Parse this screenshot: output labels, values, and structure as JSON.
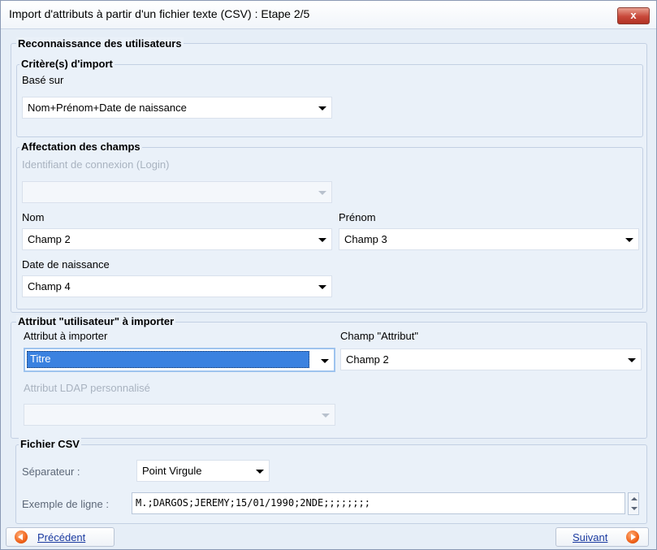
{
  "window": {
    "title": "Import d'attributs à partir d'un fichier texte (CSV) : Etape 2/5",
    "close_label": "x"
  },
  "reconnaissance": {
    "legend": "Reconnaissance des utilisateurs",
    "criteres": {
      "legend": "Critère(s) d'import",
      "base_sur_label": "Basé sur",
      "base_sur_value": "Nom+Prénom+Date de naissance"
    },
    "affectation": {
      "legend": "Affectation des champs",
      "login_label": "Identifiant de connexion (Login)",
      "login_value": "",
      "nom_label": "Nom",
      "nom_value": "Champ 2",
      "prenom_label": "Prénom",
      "prenom_value": "Champ 3",
      "naissance_label": "Date de naissance",
      "naissance_value": "Champ 4"
    }
  },
  "attribut": {
    "legend": "Attribut \"utilisateur\" à importer",
    "attribut_label": "Attribut à importer",
    "attribut_value": "Titre",
    "champ_label": "Champ \"Attribut\"",
    "champ_value": "Champ 2",
    "ldap_label": "Attribut LDAP personnalisé",
    "ldap_value": ""
  },
  "csv": {
    "legend": "Fichier CSV",
    "separateur_label": "Séparateur :",
    "separateur_value": "Point Virgule",
    "exemple_label": "Exemple de ligne :",
    "exemple_value": "M.;DARGOS;JEREMY;15/01/1990;2NDE;;;;;;;;"
  },
  "footer": {
    "prev_label": "Précédent",
    "next_label": "Suivant"
  }
}
